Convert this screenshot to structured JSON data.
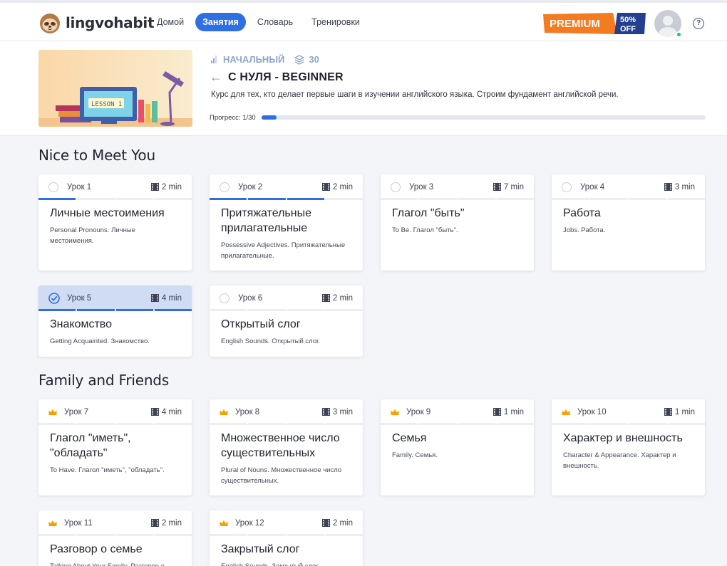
{
  "app": {
    "brand": "lingvohabit",
    "nav": [
      "Домой",
      "Занятия",
      "Словарь",
      "Тренировки"
    ],
    "nav_active": 1,
    "premium": {
      "label": "PREMIUM",
      "badge_top": "50%",
      "badge_bottom": "OFF",
      "color": "#f47b20",
      "badge_color": "#233f8f"
    },
    "help_symbol": "?"
  },
  "course": {
    "level": "НАЧАЛЬНЫЙ",
    "lessons_count": "30",
    "title": "С НУЛЯ - BEGINNER",
    "description": "Курс для тех, кто делает первые шаги в изучении английского языка. Строим фундамент английской речи.",
    "progress_label": "Прогресс: 1/30",
    "progress_fraction": 0.033,
    "cover_text": "LESSON 1"
  },
  "sections": [
    {
      "title": "Nice to Meet You",
      "lessons": [
        {
          "num": "Урок 1",
          "duration": "2 min",
          "title": "Личные местоимения",
          "subtitle": "Personal Pronouns. Личные местоимения.",
          "status": "open",
          "segments": [
            1,
            0,
            0,
            0
          ]
        },
        {
          "num": "Урок 2",
          "duration": "2 min",
          "title": "Притяжательные прилагательные",
          "subtitle": "Possessive Adjectives. Притяжательные прилагательные.",
          "status": "open",
          "segments": [
            1,
            1,
            1,
            0
          ]
        },
        {
          "num": "Урок 3",
          "duration": "7 min",
          "title": "Глагол \"быть\"",
          "subtitle": "To Be. Глагол \"быть\".",
          "status": "open",
          "segments": [
            0,
            0,
            0,
            0
          ]
        },
        {
          "num": "Урок 4",
          "duration": "3 min",
          "title": "Работа",
          "subtitle": "Jobs. Работа.",
          "status": "open",
          "segments": [
            0,
            0,
            0,
            0
          ]
        },
        {
          "num": "Урок 5",
          "duration": "4 min",
          "title": "Знакомство",
          "subtitle": "Getting Acquainted. Знакомство.",
          "status": "done",
          "segments": [
            1,
            1,
            1,
            1
          ]
        },
        {
          "num": "Урок 6",
          "duration": "2 min",
          "title": "Открытый слог",
          "subtitle": "English Sounds. Открытый слог.",
          "status": "open",
          "segments": [
            0,
            0,
            0,
            0
          ]
        }
      ]
    },
    {
      "title": "Family and Friends",
      "lessons": [
        {
          "num": "Урок 7",
          "duration": "4 min",
          "title": "Глагол \"иметь\", \"обладать\"",
          "subtitle": "To Have. Глагол \"иметь\", \"обладать\".",
          "status": "premium",
          "segments": [
            0,
            0,
            0,
            0
          ]
        },
        {
          "num": "Урок 8",
          "duration": "3 min",
          "title": "Множественное число существительных",
          "subtitle": "Plural of Nouns. Множественное число существительных.",
          "status": "premium",
          "segments": [
            0,
            0,
            0,
            0
          ]
        },
        {
          "num": "Урок 9",
          "duration": "1 min",
          "title": "Семья",
          "subtitle": "Family. Семья.",
          "status": "premium",
          "segments": [
            0,
            0,
            0,
            0
          ]
        },
        {
          "num": "Урок 10",
          "duration": "1 min",
          "title": "Характер и внешность",
          "subtitle": "Character & Appearance. Характер и внешность.",
          "status": "premium",
          "segments": [
            0,
            0,
            0,
            0
          ]
        },
        {
          "num": "Урок 11",
          "duration": "2 min",
          "title": "Разговор о семье",
          "subtitle": "Talking About Your Family. Разговор о семье.",
          "status": "premium",
          "segments": [
            0,
            0,
            0,
            0
          ]
        },
        {
          "num": "Урок 12",
          "duration": "2 min",
          "title": "Закрытый слог",
          "subtitle": "English Sounds. Закрытый слог.",
          "status": "premium",
          "segments": [
            0,
            0,
            0,
            0
          ]
        }
      ]
    }
  ],
  "colors": {
    "accent": "#2f6fe4",
    "done_header": "#cfdcf3",
    "crown": "#f5a300"
  }
}
